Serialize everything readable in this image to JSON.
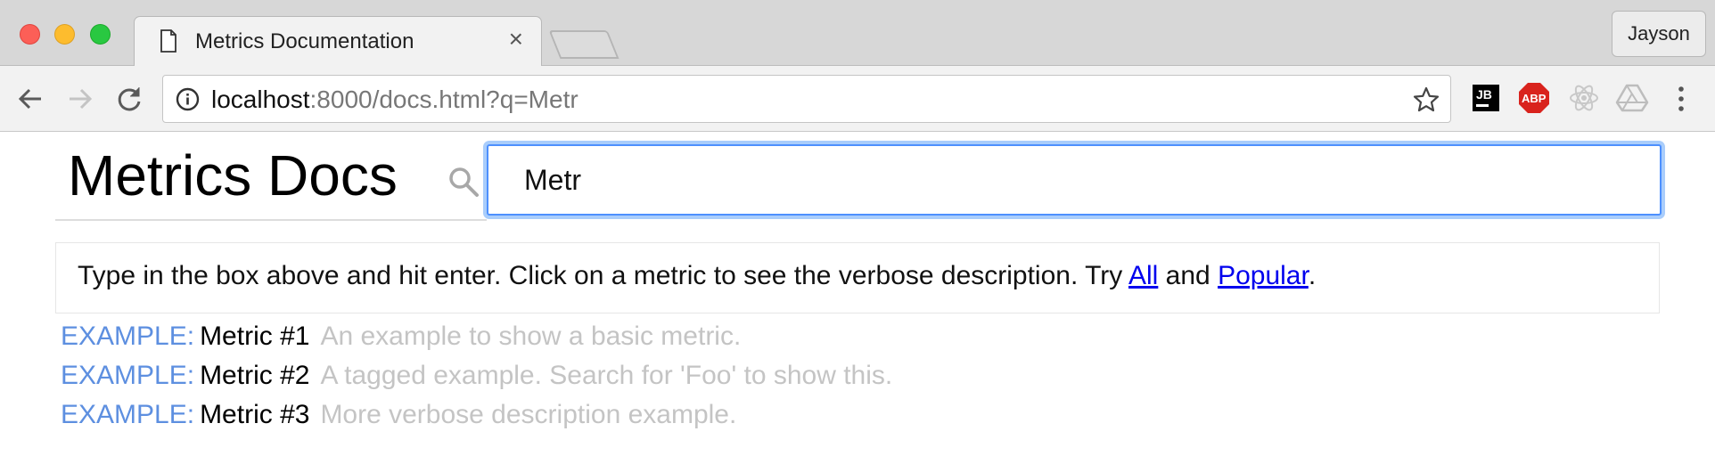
{
  "browser": {
    "tab_title": "Metrics Documentation",
    "tab_close": "×",
    "profile_name": "Jayson",
    "url_host": "localhost",
    "url_rest": ":8000/docs.html?q=Metr",
    "extensions": [
      "jetbrains-icon",
      "adblock-plus-icon",
      "react-devtools-icon",
      "google-drive-icon"
    ],
    "abp_label": "ABP",
    "jb_label": "JB"
  },
  "page": {
    "title": "Metrics Docs",
    "search": {
      "value": "Metr"
    },
    "hint": {
      "text_before": "Type in the box above and hit enter. Click on a metric to see the verbose description. Try ",
      "link_all": "All",
      "text_and": " and ",
      "link_popular": "Popular",
      "text_end": "."
    },
    "results": [
      {
        "tag": "EXAMPLE:",
        "name": "Metric #1",
        "description": "An example to show a basic metric."
      },
      {
        "tag": "EXAMPLE:",
        "name": "Metric #2",
        "description": "A tagged example. Search for 'Foo' to show this."
      },
      {
        "tag": "EXAMPLE:",
        "name": "Metric #3",
        "description": "More verbose description example."
      }
    ]
  },
  "colors": {
    "accent_focus": "#4d90fe",
    "tag_blue": "#5d8fe0",
    "link_blue": "#0000ee",
    "description_gray": "#c4c4c4"
  }
}
